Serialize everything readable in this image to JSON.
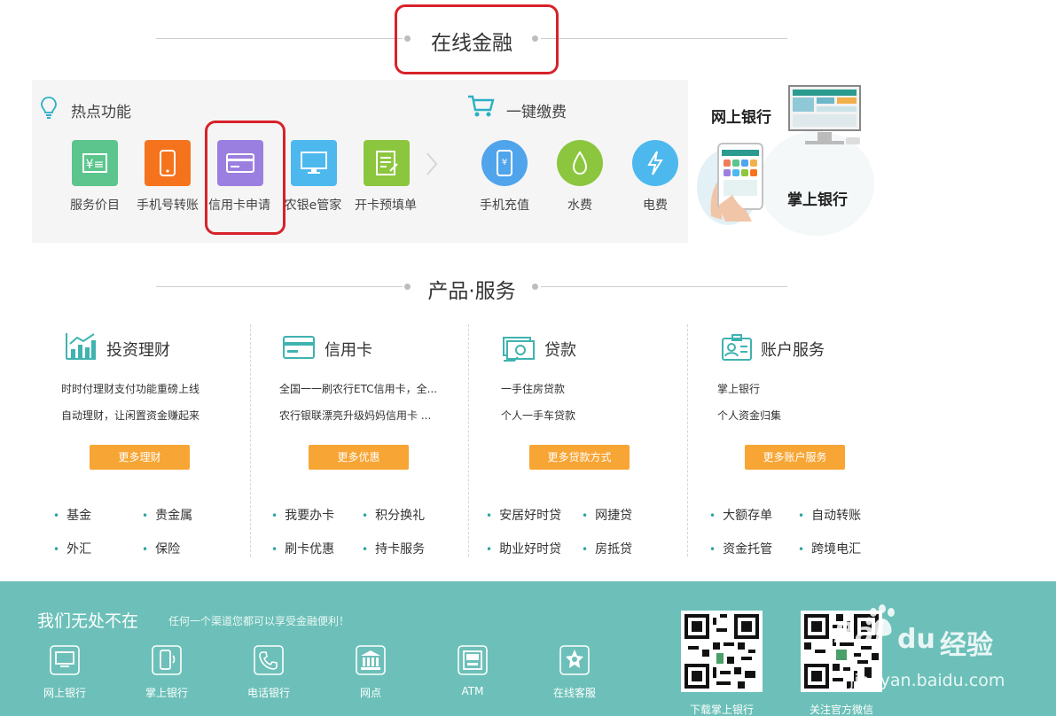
{
  "section_online": {
    "title": "在线金融"
  },
  "hot": {
    "title": "热点功能",
    "items": [
      {
        "label": "服务价目",
        "icon": "price-list-icon",
        "color": "#5bc58d"
      },
      {
        "label": "手机号转账",
        "icon": "phone-transfer-icon",
        "color": "#f5731d"
      },
      {
        "label": "信用卡申请",
        "icon": "credit-card-icon",
        "color": "#9b7fe0"
      },
      {
        "label": "农银e管家",
        "icon": "monitor-icon",
        "color": "#4cb8ee"
      },
      {
        "label": "开卡预填单",
        "icon": "form-icon",
        "color": "#8cc63e"
      }
    ]
  },
  "pay": {
    "title": "一键缴费",
    "items": [
      {
        "label": "手机充值",
        "icon": "phone-recharge-icon",
        "color": "#4fa4ec"
      },
      {
        "label": "水费",
        "icon": "water-drop-icon",
        "color": "#8cc63e"
      },
      {
        "label": "电费",
        "icon": "lightning-icon",
        "color": "#4cb8ee"
      }
    ]
  },
  "promo": {
    "web_bank": "网上银行",
    "mobile_bank": "掌上银行"
  },
  "section_products": {
    "title": "产品·服务"
  },
  "products": [
    {
      "title": "投资理财",
      "icon": "chart-icon",
      "lines": [
        "时时付理财支付功能重磅上线",
        "自动理财，让闲置资金赚起来"
      ],
      "button": "更多理财",
      "links": [
        "基金",
        "贵金属",
        "外汇",
        "保险"
      ]
    },
    {
      "title": "信用卡",
      "icon": "card-icon",
      "lines": [
        "全国一一刷农行ETC信用卡，全...",
        "农行银联漂亮升级妈妈信用卡 ..."
      ],
      "button": "更多优惠",
      "links": [
        "我要办卡",
        "积分换礼",
        "刷卡优惠",
        "持卡服务"
      ]
    },
    {
      "title": "贷款",
      "icon": "loan-icon",
      "lines": [
        "一手住房贷款",
        "个人一手车贷款"
      ],
      "button": "更多贷款方式",
      "links": [
        "安居好时贷",
        "网捷贷",
        "助业好时贷",
        "房抵贷"
      ]
    },
    {
      "title": "账户服务",
      "icon": "id-card-icon",
      "lines": [
        "掌上银行",
        "个人资金归集"
      ],
      "button": "更多账户服务",
      "links": [
        "大额存单",
        "自动转账",
        "资金托管",
        "跨境电汇"
      ]
    }
  ],
  "footer": {
    "title": "我们无处不在",
    "subtitle": "任何一个渠道您都可以享受金融便利！",
    "channels": [
      {
        "label": "网上银行",
        "icon": "computer-icon"
      },
      {
        "label": "掌上银行",
        "icon": "mobile-icon"
      },
      {
        "label": "电话银行",
        "icon": "telephone-icon"
      },
      {
        "label": "网点",
        "icon": "bank-building-icon"
      },
      {
        "label": "ATM",
        "icon": "atm-icon"
      },
      {
        "label": "在线客服",
        "icon": "customer-service-icon"
      }
    ],
    "qr": [
      {
        "label": "下载掌上银行"
      },
      {
        "label": "关注官方微信"
      }
    ]
  },
  "watermark": {
    "brand": "Bai",
    "du": "du",
    "jingyan": "经验",
    "url": "jingyan.baidu.com"
  }
}
